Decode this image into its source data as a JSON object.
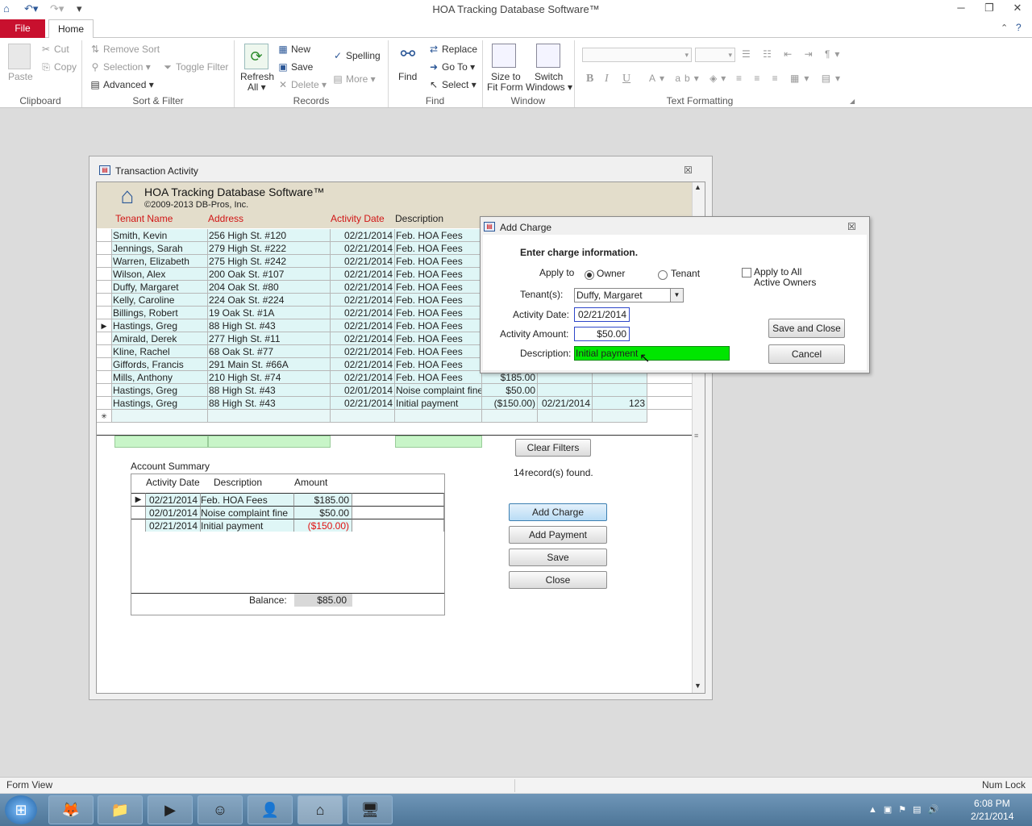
{
  "window": {
    "title": "HOA Tracking Database Software™"
  },
  "ribbon": {
    "tabs": {
      "file": "File",
      "home": "Home"
    },
    "clipboard": {
      "label": "Clipboard",
      "paste": "Paste",
      "cut": "Cut",
      "copy": "Copy"
    },
    "sort_filter": {
      "label": "Sort & Filter",
      "remove_sort": "Remove Sort",
      "selection": "Selection",
      "advanced": "Advanced",
      "toggle_filter": "Toggle Filter"
    },
    "records": {
      "label": "Records",
      "refresh": "Refresh",
      "refresh_all": "All",
      "new": "New",
      "save": "Save",
      "delete": "Delete",
      "more": "More",
      "spelling": "Spelling"
    },
    "find": {
      "label": "Find",
      "find": "Find",
      "replace": "Replace",
      "goto": "Go To",
      "select": "Select"
    },
    "window": {
      "label": "Window",
      "size1": "Size to",
      "size2": "Fit Form",
      "switch1": "Switch",
      "switch2": "Windows"
    },
    "text_formatting": {
      "label": "Text Formatting",
      "bold": "B",
      "italic": "I",
      "underline": "U"
    }
  },
  "form": {
    "title": "Transaction Activity",
    "app_name": "HOA Tracking Database Software™",
    "copyright": "©2009-2013 DB-Pros, Inc.",
    "columns": {
      "tenant": "Tenant Name",
      "address": "Address",
      "activity_date": "Activity Date",
      "description": "Description"
    },
    "rows": [
      {
        "name": "Smith, Kevin",
        "address": "256 High St. #120",
        "date": "02/21/2014",
        "desc": "Feb. HOA Fees",
        "amount": "",
        "date2": "",
        "ref": ""
      },
      {
        "name": "Jennings, Sarah",
        "address": "279 High St. #222",
        "date": "02/21/2014",
        "desc": "Feb. HOA Fees",
        "amount": "",
        "date2": "",
        "ref": ""
      },
      {
        "name": "Warren, Elizabeth",
        "address": "275 High St. #242",
        "date": "02/21/2014",
        "desc": "Feb. HOA Fees",
        "amount": "",
        "date2": "",
        "ref": ""
      },
      {
        "name": "Wilson, Alex",
        "address": "200 Oak St. #107",
        "date": "02/21/2014",
        "desc": "Feb. HOA Fees",
        "amount": "",
        "date2": "",
        "ref": ""
      },
      {
        "name": "Duffy, Margaret",
        "address": "204 Oak St. #80",
        "date": "02/21/2014",
        "desc": "Feb. HOA Fees",
        "amount": "",
        "date2": "",
        "ref": ""
      },
      {
        "name": "Kelly, Caroline",
        "address": "224 Oak St. #224",
        "date": "02/21/2014",
        "desc": "Feb. HOA Fees",
        "amount": "",
        "date2": "",
        "ref": ""
      },
      {
        "name": "Billings, Robert",
        "address": "19 Oak St. #1A",
        "date": "02/21/2014",
        "desc": "Feb. HOA Fees",
        "amount": "",
        "date2": "",
        "ref": ""
      },
      {
        "name": "Hastings, Greg",
        "address": "88 High St. #43",
        "date": "02/21/2014",
        "desc": "Feb. HOA Fees",
        "amount": "",
        "date2": "",
        "ref": ""
      },
      {
        "name": "Amirald, Derek",
        "address": "277 High St. #11",
        "date": "02/21/2014",
        "desc": "Feb. HOA Fees",
        "amount": "",
        "date2": "",
        "ref": ""
      },
      {
        "name": "Kline, Rachel",
        "address": "68 Oak St. #77",
        "date": "02/21/2014",
        "desc": "Feb. HOA Fees",
        "amount": "",
        "date2": "",
        "ref": ""
      },
      {
        "name": "Giffords, Francis",
        "address": "291 Main St. #66A",
        "date": "02/21/2014",
        "desc": "Feb. HOA Fees",
        "amount": "",
        "date2": "",
        "ref": ""
      },
      {
        "name": "Mills, Anthony",
        "address": "210 High St. #74",
        "date": "02/21/2014",
        "desc": "Feb. HOA Fees",
        "amount": "$185.00",
        "date2": "",
        "ref": ""
      },
      {
        "name": "Hastings, Greg",
        "address": "88 High St. #43",
        "date": "02/01/2014",
        "desc": "Noise complaint fine",
        "amount": "$50.00",
        "date2": "",
        "ref": ""
      },
      {
        "name": "Hastings, Greg",
        "address": "88 High St. #43",
        "date": "02/21/2014",
        "desc": "Initial payment",
        "amount": "($150.00)",
        "date2": "02/21/2014",
        "ref": "123"
      }
    ],
    "new_row_marker": "✳",
    "clear_filters": "Clear Filters",
    "records_count": "14",
    "records_found": "record(s) found.",
    "summary": {
      "title": "Account Summary",
      "columns": {
        "date": "Activity Date",
        "desc": "Description",
        "amount": "Amount"
      },
      "rows": [
        {
          "date": "02/21/2014",
          "desc": "Feb. HOA Fees",
          "amount": "$185.00"
        },
        {
          "date": "02/01/2014",
          "desc": "Noise complaint fine",
          "amount": "$50.00"
        },
        {
          "date": "02/21/2014",
          "desc": "Initial payment",
          "amount": "($150.00)"
        }
      ],
      "balance_label": "Balance:",
      "balance": "$85.00"
    },
    "buttons": {
      "add_charge": "Add Charge",
      "add_payment": "Add Payment",
      "save": "Save",
      "close": "Close"
    }
  },
  "dialog": {
    "title": "Add Charge",
    "heading": "Enter charge information.",
    "apply_to": "Apply to",
    "owner": "Owner",
    "tenant": "Tenant",
    "apply_all1": "Apply to All",
    "apply_all2": "Active Owners",
    "tenants_label": "Tenant(s):",
    "tenants_value": "Duffy, Margaret",
    "date_label": "Activity Date:",
    "date_value": "02/21/2014",
    "amount_label": "Activity Amount:",
    "amount_value": "$50.00",
    "desc_label": "Description:",
    "desc_value": "Initial payment",
    "save_close": "Save and Close",
    "cancel": "Cancel"
  },
  "status": {
    "left": "Form View",
    "right": "Num Lock"
  },
  "clock": {
    "time": "6:08 PM",
    "date": "2/21/2014"
  },
  "colors": {
    "file_tab": "#c8102e",
    "desc_highlight": "#00e600",
    "negative": "#e01010",
    "header_red": "#d01515"
  }
}
